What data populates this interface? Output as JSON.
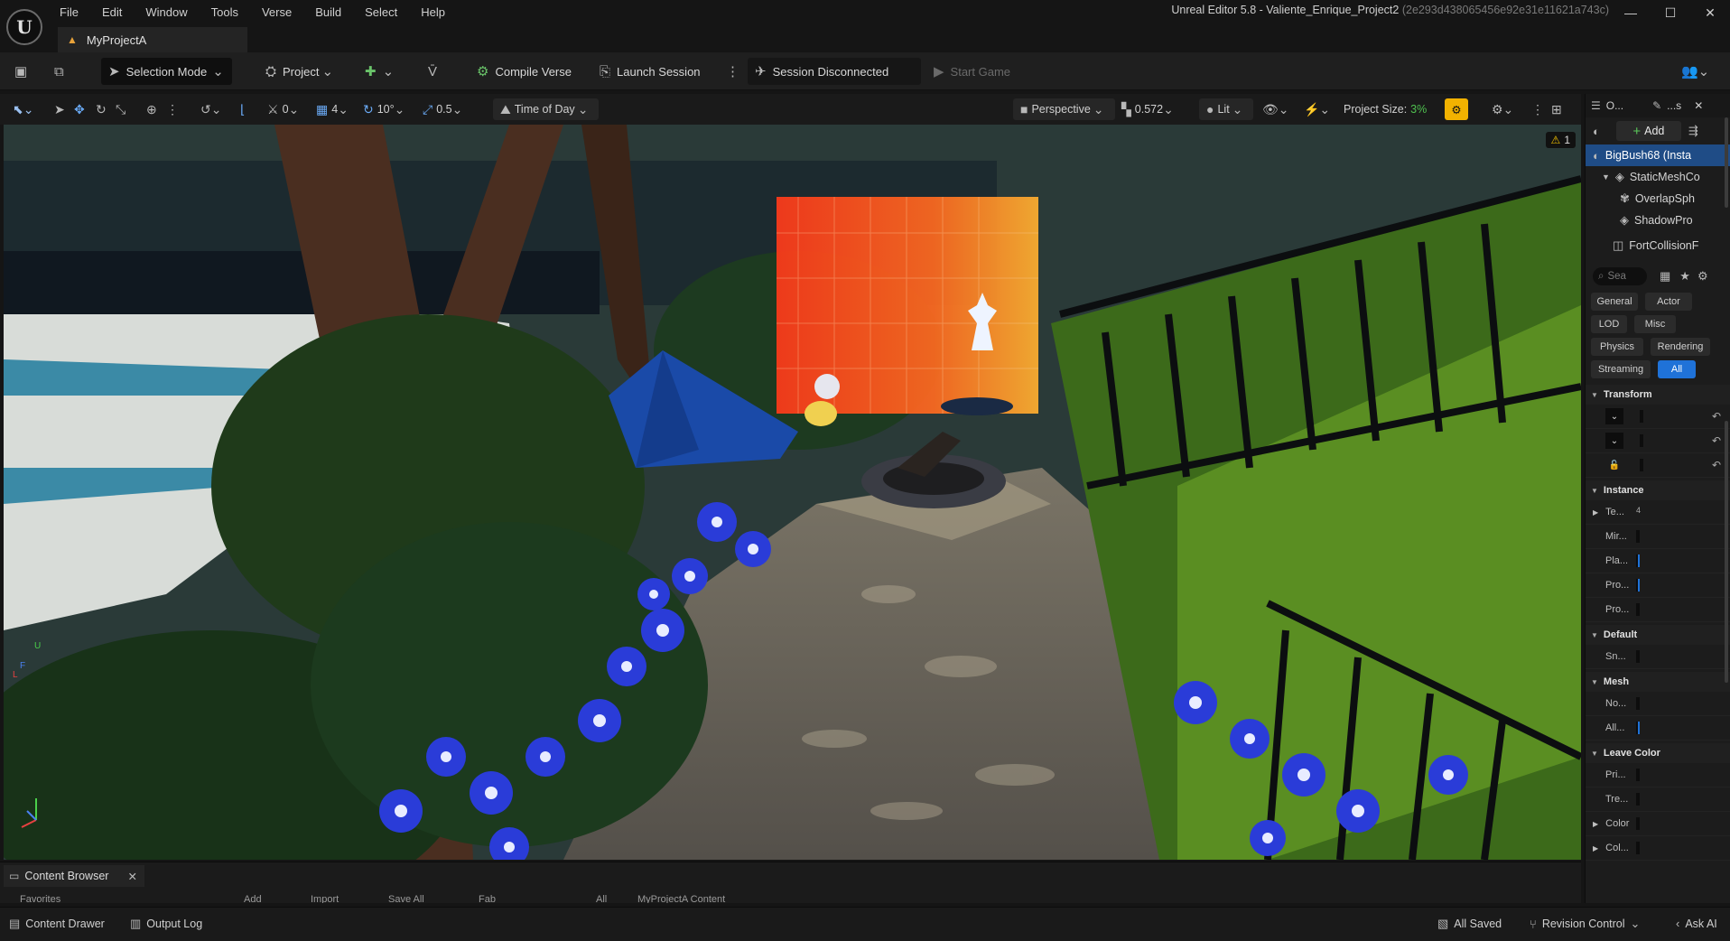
{
  "window": {
    "title": "Unreal Editor 5.8 - Valiente_Enrique_Project2",
    "hash": "(2e293d438065456e92e31e11621a743c)",
    "minimize": "—",
    "maximize": "☐",
    "close": "✕"
  },
  "menu": [
    "File",
    "Edit",
    "Window",
    "Tools",
    "Verse",
    "Build",
    "Select",
    "Help"
  ],
  "project_tab": "MyProjectA",
  "toolbar": {
    "selection_mode": "Selection Mode",
    "project": "Project",
    "compile_verse": "Compile Verse",
    "launch_session": "Launch Session",
    "session_status": "Session Disconnected",
    "start_game": "Start Game"
  },
  "viewport_toolbar": {
    "grid_snap_a": "0",
    "grid_snap_b": "4",
    "rotation_snap": "10°",
    "scale_snap": "0.5",
    "time_of_day": "Time of Day",
    "perspective": "Perspective",
    "camera_speed": "0.572",
    "lit": "Lit",
    "project_size_label": "Project Size:",
    "project_size_value": "3%"
  },
  "viewport": {
    "warning_count": "1",
    "axis_labels": [
      "U",
      "F",
      "L"
    ]
  },
  "right_panel": {
    "tab_outliner": "O...",
    "tab_details": "...s",
    "add_button": "Add",
    "tree": [
      {
        "label": "BigBush68 (Insta",
        "selected": true
      },
      {
        "label": "StaticMeshCo",
        "selected": false
      },
      {
        "label": "OverlapSph",
        "selected": false
      },
      {
        "label": "ShadowPro",
        "selected": false
      },
      {
        "label": "FortCollisionF",
        "selected": false
      }
    ],
    "search_placeholder": "Sea",
    "categories": [
      "General",
      "Actor",
      "LOD",
      "Misc",
      "Physics",
      "Rendering",
      "Streaming",
      "All"
    ],
    "active_category": "All",
    "sections": {
      "transform": "Transform",
      "instance": "Instance",
      "default": "Default",
      "mesh": "Mesh",
      "leave_color": "Leave Color"
    },
    "instance_props": [
      "Te...",
      "Mir...",
      "Pla...",
      "Pro...",
      "Pro..."
    ],
    "default_props": [
      "Sn..."
    ],
    "mesh_props": [
      "No...",
      "All..."
    ],
    "leave_color_props": [
      "Pri...",
      "Tre...",
      "Color",
      "Col..."
    ]
  },
  "content_browser": {
    "tab": "Content Browser",
    "strip": [
      "Favorites",
      "Add",
      "Import",
      "Save All",
      "Fab",
      "All",
      "MyProjectA Content"
    ]
  },
  "status_bar": {
    "content_drawer": "Content Drawer",
    "output_log": "Output Log",
    "all_saved": "All Saved",
    "revision_control": "Revision Control",
    "ask_ai": "Ask AI"
  }
}
